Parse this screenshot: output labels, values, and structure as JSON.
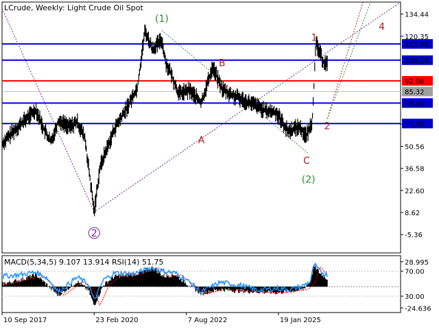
{
  "header": {
    "title": "LCrude, Weekly:  Light Crude Oil Spot"
  },
  "indicator_header": "MACD(5,34,5) 9.107 13.914 RSI(14) 51.75",
  "colors": {
    "price": "#000000",
    "support_resistance": "#0000cc",
    "pivot": "#ff0000",
    "current": "#a0a0a0",
    "wave_green": "#2e8b2e",
    "wave_red": "#b02020",
    "wave_purple": "#702090",
    "rsi": "#1e90ff",
    "signal": "#ff0000"
  },
  "chart_data": [
    {
      "type": "line",
      "title": "LCrude, Weekly:  Light Crude Oil Spot",
      "xlabel": "",
      "ylabel": "",
      "ylim": [
        -17,
        142
      ],
      "x_tick_labels": [
        "10 Sep 2017",
        "23 Feb 2020",
        "7 Aug 2022",
        "19 Jan 2025"
      ],
      "x_tick_positions": [
        0.0,
        2.45,
        4.9,
        7.35
      ],
      "xlim": [
        0,
        10.6
      ],
      "y_tick_labels": [
        "134.44",
        "120.35",
        "64.56",
        "50.56",
        "36.58",
        "22.60",
        "8.62",
        "-5.36"
      ],
      "y_tick_values": [
        134.44,
        120.35,
        64.56,
        50.56,
        36.58,
        22.6,
        8.62,
        -5.36
      ],
      "price_series": {
        "name": "LCrude",
        "x": [
          0,
          0.3,
          0.6,
          0.9,
          1.1,
          1.3,
          1.5,
          1.8,
          2.0,
          2.2,
          2.45,
          2.6,
          2.8,
          3.0,
          3.3,
          3.6,
          3.8,
          4.0,
          4.25,
          4.35,
          4.5,
          4.7,
          5.0,
          5.3,
          5.6,
          5.85,
          6.1,
          6.4,
          6.7,
          7.0,
          7.3,
          7.6,
          7.9,
          8.1,
          8.25,
          8.35,
          8.45,
          8.55,
          8.65
        ],
        "values": [
          52,
          60,
          67,
          74,
          62,
          53,
          67,
          63,
          66,
          56,
          9,
          37,
          50,
          62,
          74,
          88,
          124,
          112,
          118,
          104,
          96,
          84,
          86,
          78,
          101,
          87,
          83,
          80,
          77,
          73,
          72,
          60,
          63,
          57,
          67,
          116,
          110,
          104,
          103
        ]
      },
      "levels": [
        {
          "label": "115.45",
          "value": 115.45,
          "kind": "resistance"
        },
        {
          "label": "105.17",
          "value": 105.17,
          "kind": "resistance"
        },
        {
          "label": "92.06",
          "value": 92.06,
          "kind": "pivot"
        },
        {
          "label": "85.32",
          "value": 85.32,
          "kind": "current"
        },
        {
          "label": "78.00",
          "value": 78.0,
          "kind": "support"
        },
        {
          "label": "65.00",
          "value": 65.0,
          "kind": "support"
        }
      ],
      "wave_labels": [
        {
          "text": "(1)",
          "x": 4.25,
          "y": 136,
          "color": "green",
          "circled": false
        },
        {
          "text": "(2)",
          "x": 8.15,
          "y": 34,
          "color": "green",
          "circled": false
        },
        {
          "text": "2",
          "x": 2.45,
          "y": 0,
          "color": "purple",
          "circled": true
        },
        {
          "text": "A",
          "x": 5.3,
          "y": 59,
          "color": "red",
          "circled": false
        },
        {
          "text": "B",
          "x": 5.85,
          "y": 108,
          "color": "red",
          "circled": false
        },
        {
          "text": "C",
          "x": 8.1,
          "y": 46,
          "color": "red",
          "circled": false
        },
        {
          "text": "1",
          "x": 8.3,
          "y": 124,
          "color": "red",
          "circled": false
        },
        {
          "text": "2",
          "x": 8.65,
          "y": 68,
          "color": "red",
          "circled": false
        },
        {
          "text": "4",
          "x": 10.1,
          "y": 131,
          "color": "red",
          "circled": false
        }
      ]
    },
    {
      "type": "area",
      "title": "MACD(5,34,5) 9.107 13.914 RSI(14) 51.75",
      "ylim": [
        -30,
        36
      ],
      "y_tick_labels": [
        "28.995",
        "70.00",
        "30.00",
        "-24.636"
      ],
      "y_tick_values": [
        28.995,
        18,
        -11,
        -24.636
      ],
      "macd_series": {
        "name": "MACD",
        "x": [
          0,
          0.5,
          0.9,
          1.2,
          1.5,
          2.0,
          2.3,
          2.45,
          2.7,
          3.0,
          3.5,
          4.0,
          4.3,
          4.6,
          4.9,
          5.3,
          5.8,
          6.3,
          6.8,
          7.3,
          7.7,
          8.0,
          8.2,
          8.3,
          8.45,
          8.65
        ],
        "values": [
          3,
          8,
          14,
          2,
          -10,
          6,
          -4,
          -22,
          2,
          12,
          14,
          22,
          12,
          14,
          4,
          -8,
          -3,
          -5,
          -6,
          -7,
          -5,
          -3,
          6,
          24,
          16,
          9.107
        ]
      },
      "rsi_series": {
        "name": "RSI(14)",
        "x": [
          0,
          0.5,
          0.9,
          1.2,
          1.5,
          2.0,
          2.3,
          2.45,
          2.7,
          3.0,
          3.5,
          4.0,
          4.3,
          4.6,
          4.9,
          5.3,
          5.8,
          6.3,
          6.8,
          7.3,
          7.7,
          8.0,
          8.2,
          8.3,
          8.45,
          8.65
        ],
        "values": [
          12,
          14,
          17,
          10,
          -6,
          11,
          3,
          -16,
          8,
          16,
          15,
          22,
          18,
          16,
          8,
          -6,
          5,
          2,
          -4,
          -2,
          -3,
          1,
          6,
          26,
          18,
          13.914
        ]
      }
    }
  ]
}
